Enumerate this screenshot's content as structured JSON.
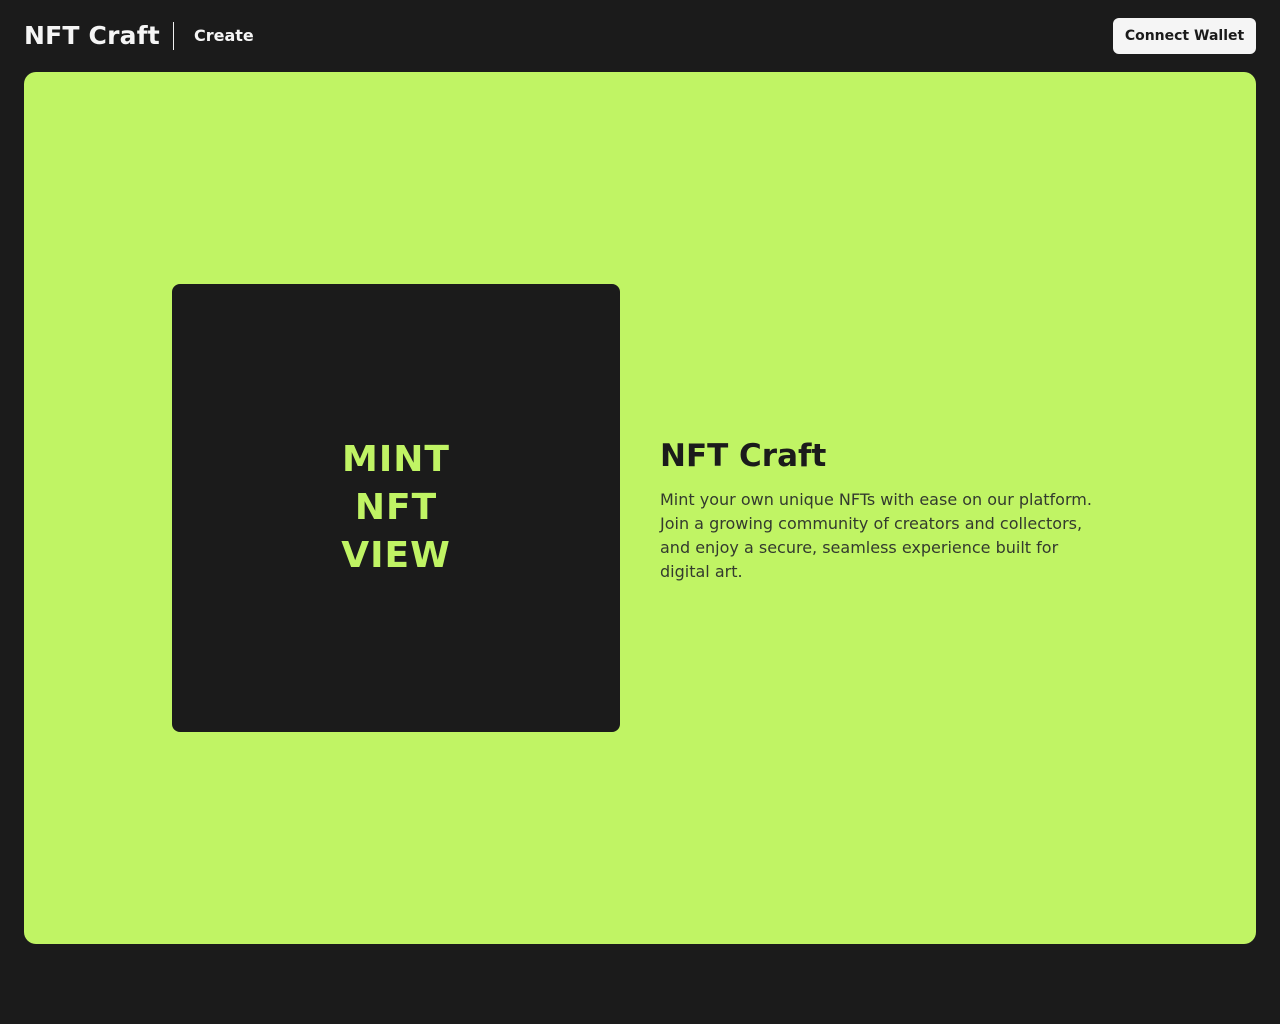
{
  "header": {
    "brand": "NFT Craft",
    "nav": {
      "create_label": "Create"
    },
    "connect_wallet_label": "Connect Wallet"
  },
  "hero": {
    "preview": {
      "lines": [
        "MINT",
        "NFT",
        "VIEW"
      ]
    },
    "title": "NFT Craft",
    "description": "Mint your own unique NFTs with ease on our platform. Join a growing community of creators and collectors, and enjoy a secure, seamless experience built for digital art."
  },
  "colors": {
    "background": "#1b1b1b",
    "accent": "#c0f464",
    "header_text": "#f5f5f5",
    "button_bg": "#f5f5f5"
  }
}
